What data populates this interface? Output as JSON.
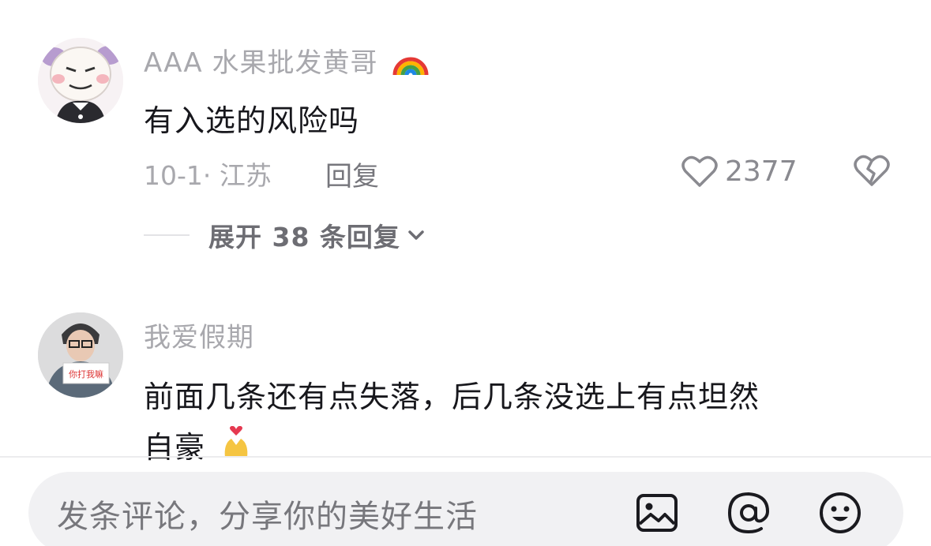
{
  "comments": [
    {
      "username": "AAA 水果批发黄哥",
      "username_emoji": "rainbow",
      "text": "有入选的风险吗",
      "date_location": "10-1· 江苏",
      "reply_label": "回复",
      "like_count": "2377",
      "expand_label": "展开 38 条回复"
    },
    {
      "username": "我爱假期",
      "text_line1": "前面几条还有点失落，后几条没选上有点坦然",
      "text_line2": "自豪",
      "avatar_sign_text": "你打我嘛"
    }
  ],
  "input_bar": {
    "placeholder": "发条评论，分享你的美好生活",
    "icons": [
      "image-icon",
      "at-icon",
      "emoji-icon"
    ]
  },
  "colors": {
    "username": "#a8a8ad",
    "text": "#17171c",
    "meta": "#a8a8ad",
    "input_bg": "#f1f1f3"
  }
}
